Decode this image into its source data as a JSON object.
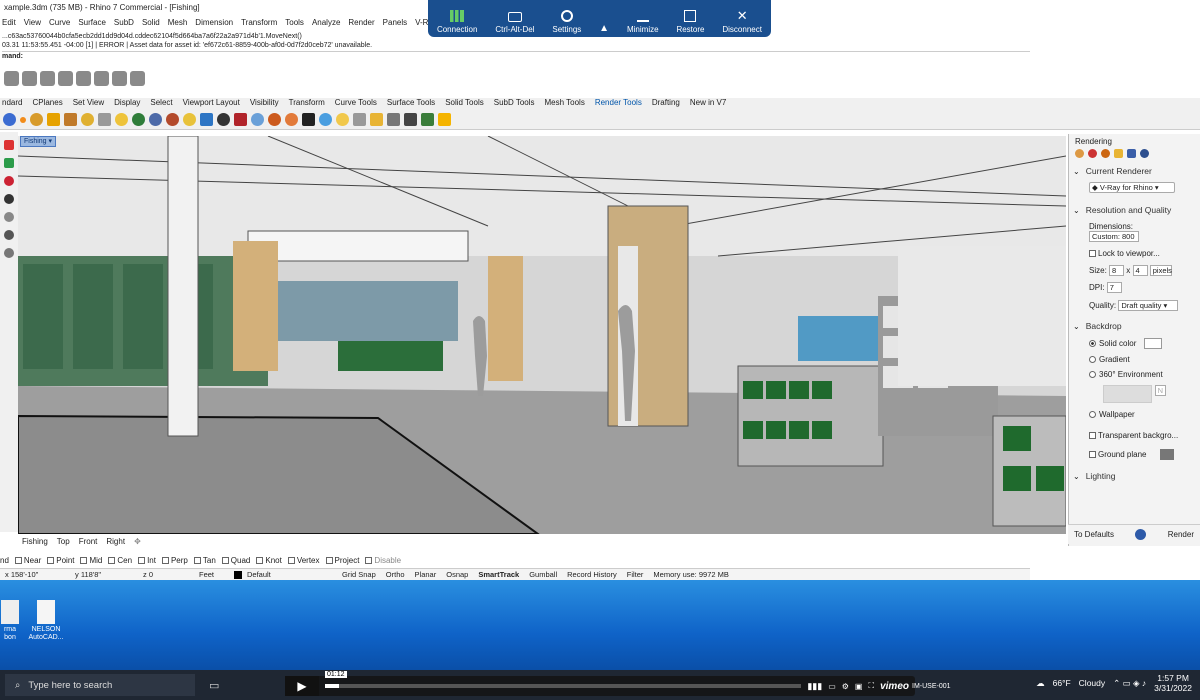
{
  "rhino": {
    "title": "xample.3dm (735 MB) - Rhino 7 Commercial - [Fishing]",
    "menu": [
      "Edit",
      "View",
      "Curve",
      "Surface",
      "SubD",
      "Solid",
      "Mesh",
      "Dimension",
      "Transform",
      "Tools",
      "Analyze",
      "Render",
      "Panels",
      "V-R"
    ],
    "cmd_lines": [
      "...c63ac53760044b0cfa5ecb2dd1dd9d04d.cddec62104f5d664ba7a6f22a2a971d4b'1.MoveNext()",
      "03.31 11:53:55.451 -04:00 [1] | ERROR | Asset data for asset id: 'ef672c61-8859-400b-af0d-0d7f2d0ceb72' unavailable."
    ],
    "cmd_prompt": "mand:",
    "tabs": [
      "ndard",
      "CPlanes",
      "Set View",
      "Display",
      "Select",
      "Viewport Layout",
      "Visibility",
      "Transform",
      "Curve Tools",
      "Surface Tools",
      "Solid Tools",
      "SubD Tools",
      "Mesh Tools",
      "Render Tools",
      "Drafting",
      "New in V7"
    ],
    "viewport_name": "Fishing",
    "view_tabs": [
      "Fishing",
      "Top",
      "Front",
      "Right",
      "✥"
    ],
    "osnaps": [
      "Near",
      "Point",
      "Mid",
      "Cen",
      "Int",
      "Perp",
      "Tan",
      "Quad",
      "Knot",
      "Vertex",
      "Project",
      "Disable"
    ],
    "osnap_first": "nd",
    "status": {
      "x": "x 158'-10\"",
      "y": "y 118'8\"",
      "z": "z 0",
      "units": "Feet",
      "layer": "Default"
    },
    "status_buttons": [
      "Grid Snap",
      "Ortho",
      "Planar",
      "Osnap",
      "SmartTrack",
      "Gumball",
      "Record History",
      "Filter"
    ],
    "memory": "Memory use: 9972 MB"
  },
  "rendering_panel": {
    "title": "Rendering",
    "current_renderer_label": "Current Renderer",
    "renderer": "V-Ray for Rhino",
    "res_label": "Resolution and Quality",
    "dimensions_label": "Dimensions:",
    "dimensions_value": "Custom: 800",
    "lock_label": "Lock to viewpor...",
    "size_label": "Size:",
    "size_w": "8",
    "size_x": "x",
    "size_h": "4",
    "size_units": "pixels",
    "dpi_label": "DPI:",
    "dpi_value": "7",
    "quality_label": "Quality:",
    "quality_value": "Draft quality",
    "backdrop_label": "Backdrop",
    "backdrop_options": [
      "Solid color",
      "Gradient",
      "360° Environment",
      "Wallpaper"
    ],
    "env_value": "N",
    "transparent_label": "Transparent backgro...",
    "ground_label": "Ground plane",
    "lighting_label": "Lighting",
    "defaults_btn": "To Defaults",
    "render_btn": "Render"
  },
  "rdp": {
    "buttons": [
      "Connection",
      "Ctrl-Alt-Del",
      "Settings",
      "Minimize",
      "Restore",
      "Disconnect"
    ]
  },
  "desktop_icons": [
    {
      "label": "rma\nbon"
    },
    {
      "label": "NELSON\nAutoCAD..."
    }
  ],
  "vimeo": {
    "time": "01:12",
    "brand": "vimeo",
    "trailing_text": "IM-USE-001"
  },
  "taskbar": {
    "search_placeholder": "Type here to search",
    "weather_temp": "66°F",
    "weather": "Cloudy",
    "time": "1:57 PM",
    "date": "3/31/2022"
  },
  "colors": {
    "rdp_bar": "#1a4f8f",
    "desktop": "#1767c9",
    "taskbar": "#1f2733"
  }
}
